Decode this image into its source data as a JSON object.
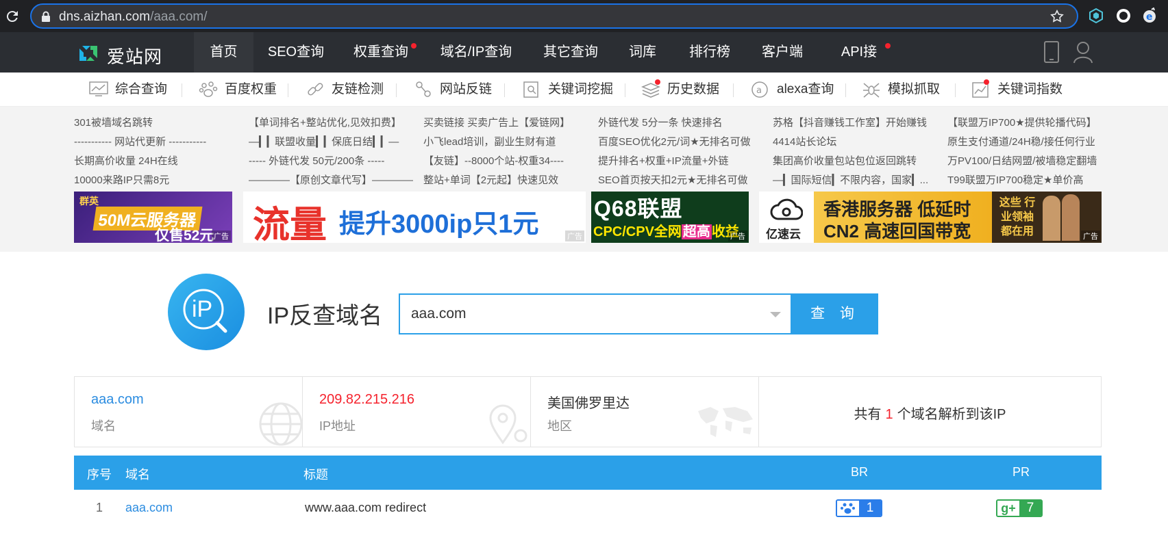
{
  "browser": {
    "url_host": "dns.aizhan.com",
    "url_path": "/aaa.com/"
  },
  "topnav": {
    "logo_text": "爱站网",
    "items": [
      "首页",
      "SEO查询",
      "权重查询",
      "域名/IP查询",
      "其它查询",
      "词库",
      "排行榜",
      "客户端",
      "API接口"
    ]
  },
  "subnav": {
    "items": [
      "综合查询",
      "百度权重",
      "友链检测",
      "网站反链",
      "关键词挖掘",
      "历史数据",
      "alexa查询",
      "模拟抓取",
      "关键词指数"
    ]
  },
  "ads": {
    "links": [
      [
        "301被墙域名跳转",
        "----------- 网站代更新 -----------",
        "长期高价收量 24H在线",
        "10000来路IP只需8元"
      ],
      [
        "【单词排名+整站优化,见效扣费】",
        "—▎▎联盟收量▎▎保底日结▎▎—",
        "----- 外链代发 50元/200条 -----",
        "————【原创文章代写】————"
      ],
      [
        "买卖链接 买卖广告上【爱链网】",
        "小飞lead培训，副业生财有道",
        "【友链】--8000个站-权重34----",
        "整站+单词【2元起】快速见效"
      ],
      [
        "外链代发 5分一条 快速排名",
        "百度SEO优化2元/词★无排名可做",
        "提升排名+权重+IP流量+外链",
        "SEO首页按天扣2元★无排名可做"
      ],
      [
        "苏格【抖音赚钱工作室】开始赚钱",
        "4414站长论坛",
        "集团高价收量包站包位返回跳转",
        "—▎国际短信▎不限内容，国家▎..."
      ],
      [
        "【联盟万IP700★提供轮播代码】",
        "原生支付通道/24H稳/接任何行业",
        "万PV100/日结网盟/被墙稳定翻墙",
        "T99联盟万IP700稳定★单价高"
      ]
    ],
    "banner1": {
      "brand": "群英",
      "line1": "50M云服务器",
      "line2": "仅售52元",
      "tag": "广告"
    },
    "banner2": {
      "big": "流量",
      "rest": "提升3000ip只1元",
      "tag": "广告"
    },
    "banner3": {
      "line1": "Q68联盟",
      "line2": "CPC/CPV全网",
      "hl": "超高",
      "tail": "收益",
      "tag": "广告"
    },
    "banner4": {
      "brand": "亿速云",
      "line1": "香港服务器 低延时",
      "line2": "CN2 高速回国带宽",
      "side": "这些 行业领袖 都在用",
      "tag": "广告"
    }
  },
  "search": {
    "logo_text": "iP",
    "title": "IP反查域名",
    "value": "aaa.com",
    "button": "查 询"
  },
  "info": {
    "domain": {
      "value": "aaa.com",
      "label": "域名"
    },
    "ip": {
      "value": "209.82.215.216",
      "label": "IP地址"
    },
    "region": {
      "value": "美国佛罗里达",
      "label": "地区"
    },
    "total": {
      "prefix": "共有",
      "count": "1",
      "suffix": "个域名解析到该IP"
    }
  },
  "table": {
    "headers": {
      "num": "序号",
      "domain": "域名",
      "title": "标题",
      "br": "BR",
      "pr": "PR"
    },
    "rows": [
      {
        "num": "1",
        "domain": "aaa.com",
        "title": "www.aaa.com redirect",
        "br": "1",
        "pr": "7"
      }
    ]
  },
  "colors": {
    "accent": "#2ba0e8",
    "link": "#2b8ce0",
    "ip": "#f5222d"
  }
}
